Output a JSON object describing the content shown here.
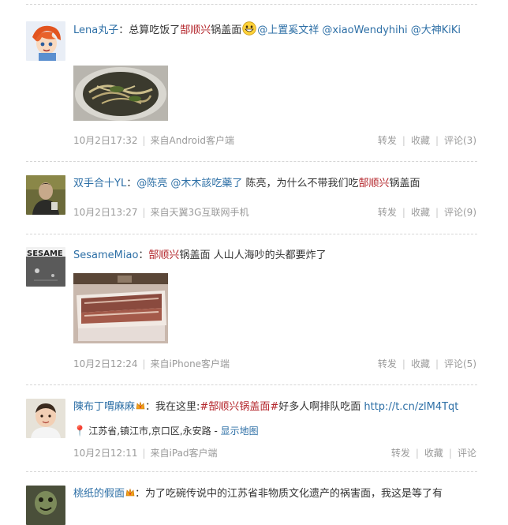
{
  "posts": [
    {
      "author": "Lena丸子",
      "colon": "：",
      "text_a": "总算吃饭了",
      "hashtag": "郜顺兴",
      "text_b": "锅盖面",
      "mentions": "@上置奚文祥 @xiaoWendyhihi @大神KiKi",
      "time": "10月2日17:32",
      "source": "来自Android客户端",
      "forward": "转发",
      "favorite": "收藏",
      "comment": "评论(3)"
    },
    {
      "author": "双手合十YL",
      "colon": "：",
      "mentions": "@陈亮 @木木該吃藥了",
      "text_a": " 陈亮，为什么不带我们吃",
      "hashtag": "郜顺兴",
      "text_b": "锅盖面",
      "time": "10月2日13:27",
      "source": "来自天翼3G互联网手机",
      "forward": "转发",
      "favorite": "收藏",
      "comment": "评论(9)"
    },
    {
      "author": "SesameMiao",
      "colon": "：",
      "hashtag": "郜顺兴",
      "text_a": "锅盖面 人山人海吵的头都要炸了",
      "avatar_text": "SESAME",
      "time": "10月2日12:24",
      "source": "来自iPhone客户端",
      "forward": "转发",
      "favorite": "收藏",
      "comment": "评论(5)"
    },
    {
      "author": "陳布丁喟麻麻",
      "colon": "：",
      "text_a": "我在这里:",
      "hashtag": "#郜顺兴锅盖面#",
      "text_b": "好多人啊排队吃面",
      "link": "http://t.cn/zlM4Tqt",
      "location": "江苏省,镇江市,京口区,永安路",
      "location_sep": " - ",
      "map_link": "显示地图",
      "time": "10月2日12:11",
      "source": "来自iPad客户端",
      "forward": "转发",
      "favorite": "收藏",
      "comment": "评论"
    },
    {
      "author": "桃纸的假面",
      "colon": "：",
      "text_a": "为了吃碗传说中的江苏省非物质文化遗产的祸害面，我这是等了有"
    }
  ],
  "colors": {
    "name": "#2d6fa6",
    "hashtag": "#b3242a",
    "meta": "#9a9a9a",
    "separator": "#d6d6d6"
  }
}
